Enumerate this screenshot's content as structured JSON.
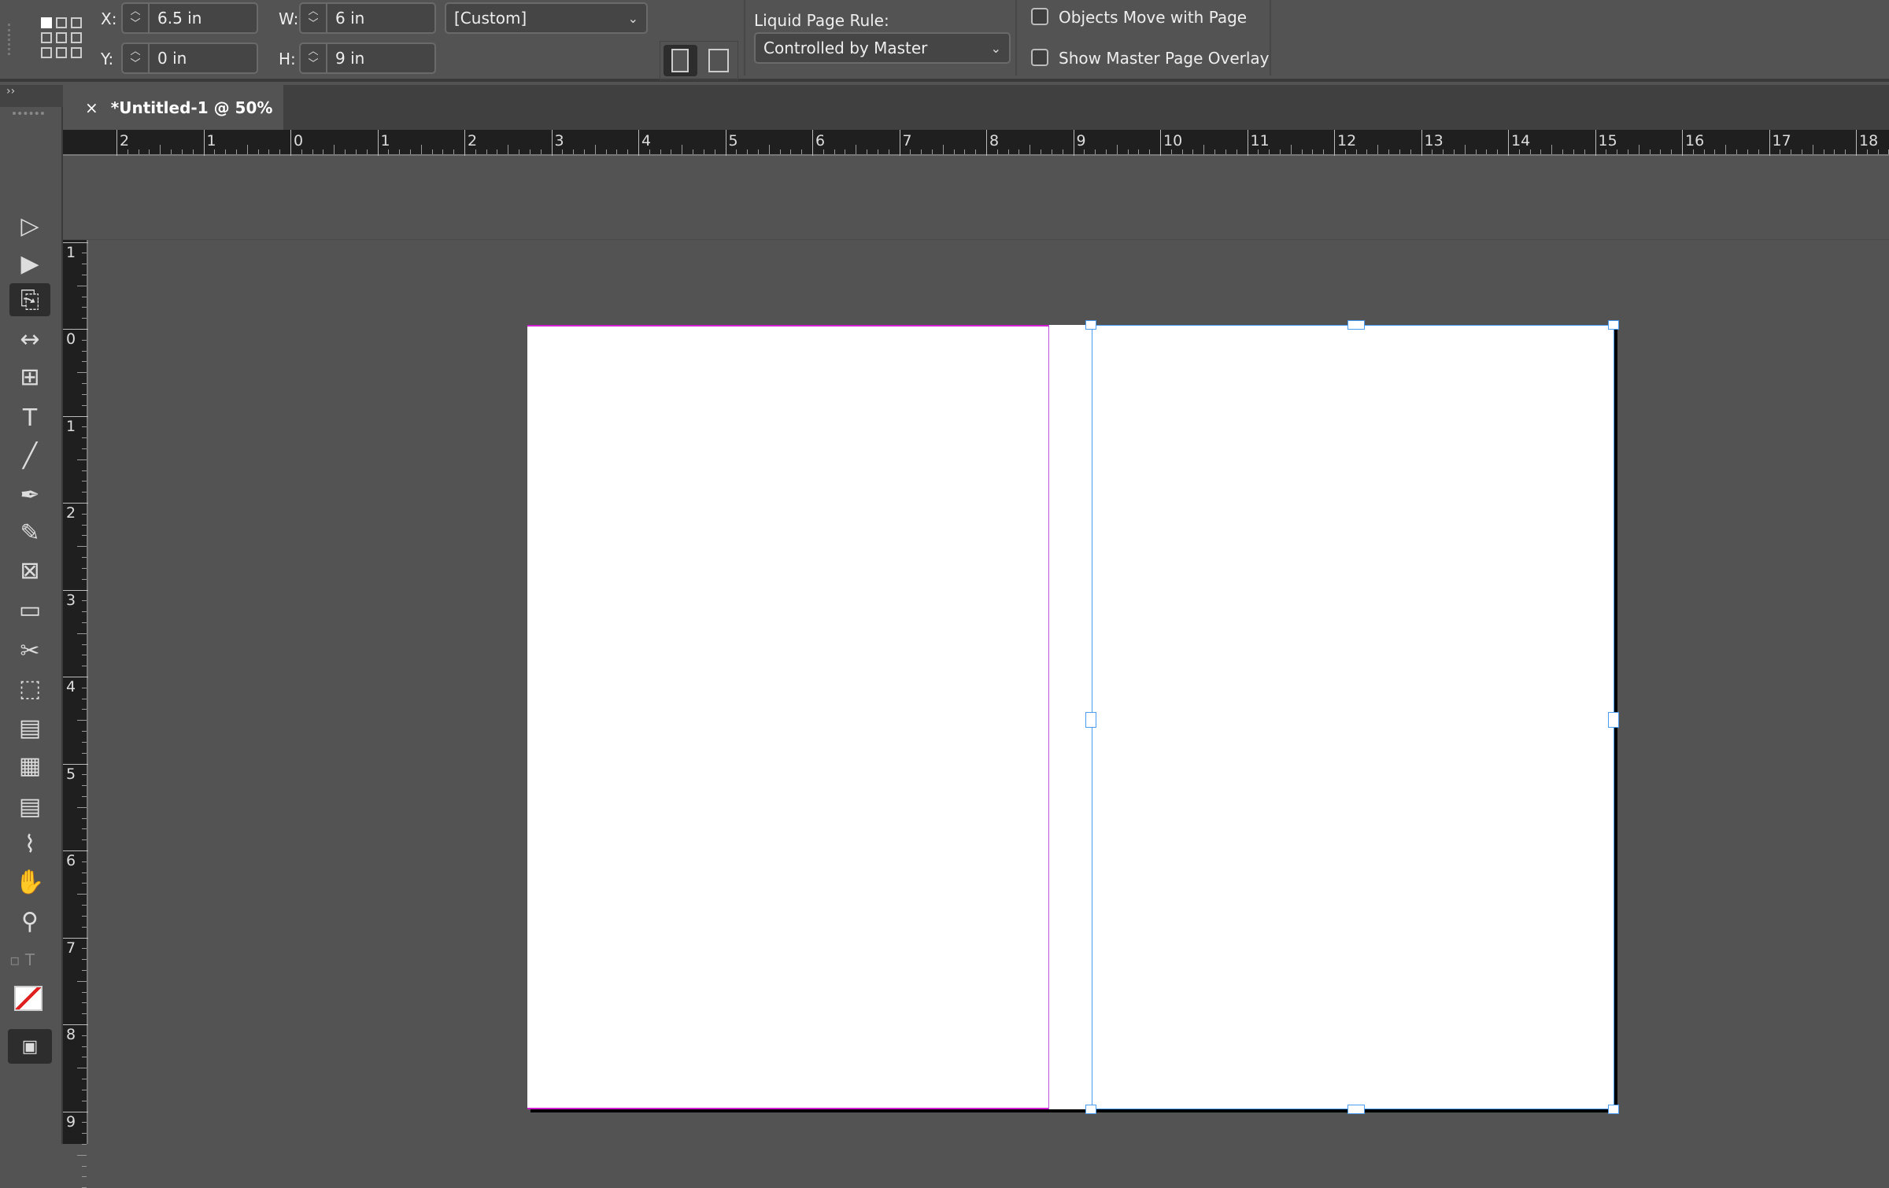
{
  "control_bar": {
    "x_label": "X:",
    "x_value": "6.5 in",
    "y_label": "Y:",
    "y_value": "0 in",
    "w_label": "W:",
    "w_value": "6 in",
    "h_label": "H:",
    "h_value": "9 in",
    "preset": "[Custom]",
    "liquid_label": "Liquid Page Rule:",
    "liquid_value": "Controlled by Master",
    "objects_move": "Objects Move with Page",
    "objects_move_checked": false,
    "show_overlay": "Show Master Page Overlay",
    "show_overlay_checked": false
  },
  "document_tab": {
    "close": "×",
    "title": "*Untitled-1 @ 50%"
  },
  "rulers": {
    "horizontal": [
      "2",
      "1",
      "0",
      "1",
      "2",
      "3",
      "4",
      "5",
      "6",
      "7",
      "8",
      "9",
      "10",
      "11",
      "12",
      "13",
      "14",
      "15",
      "16",
      "17",
      "18"
    ],
    "vertical": [
      "1",
      "0",
      "1",
      "2",
      "3",
      "4",
      "5",
      "6",
      "7",
      "8",
      "9"
    ]
  },
  "colors": {
    "accent_selection": "#4a9cf2",
    "margin_guide": "#d01ed0",
    "background": "#535353"
  },
  "tools": [
    "selection",
    "direct-selection",
    "page",
    "gap",
    "content-collector",
    "type",
    "line",
    "pen",
    "pencil",
    "rectangle-frame",
    "rectangle",
    "scissors",
    "free-transform",
    "gradient-swatch",
    "gradient-feather",
    "note",
    "eyedropper",
    "hand",
    "zoom"
  ]
}
